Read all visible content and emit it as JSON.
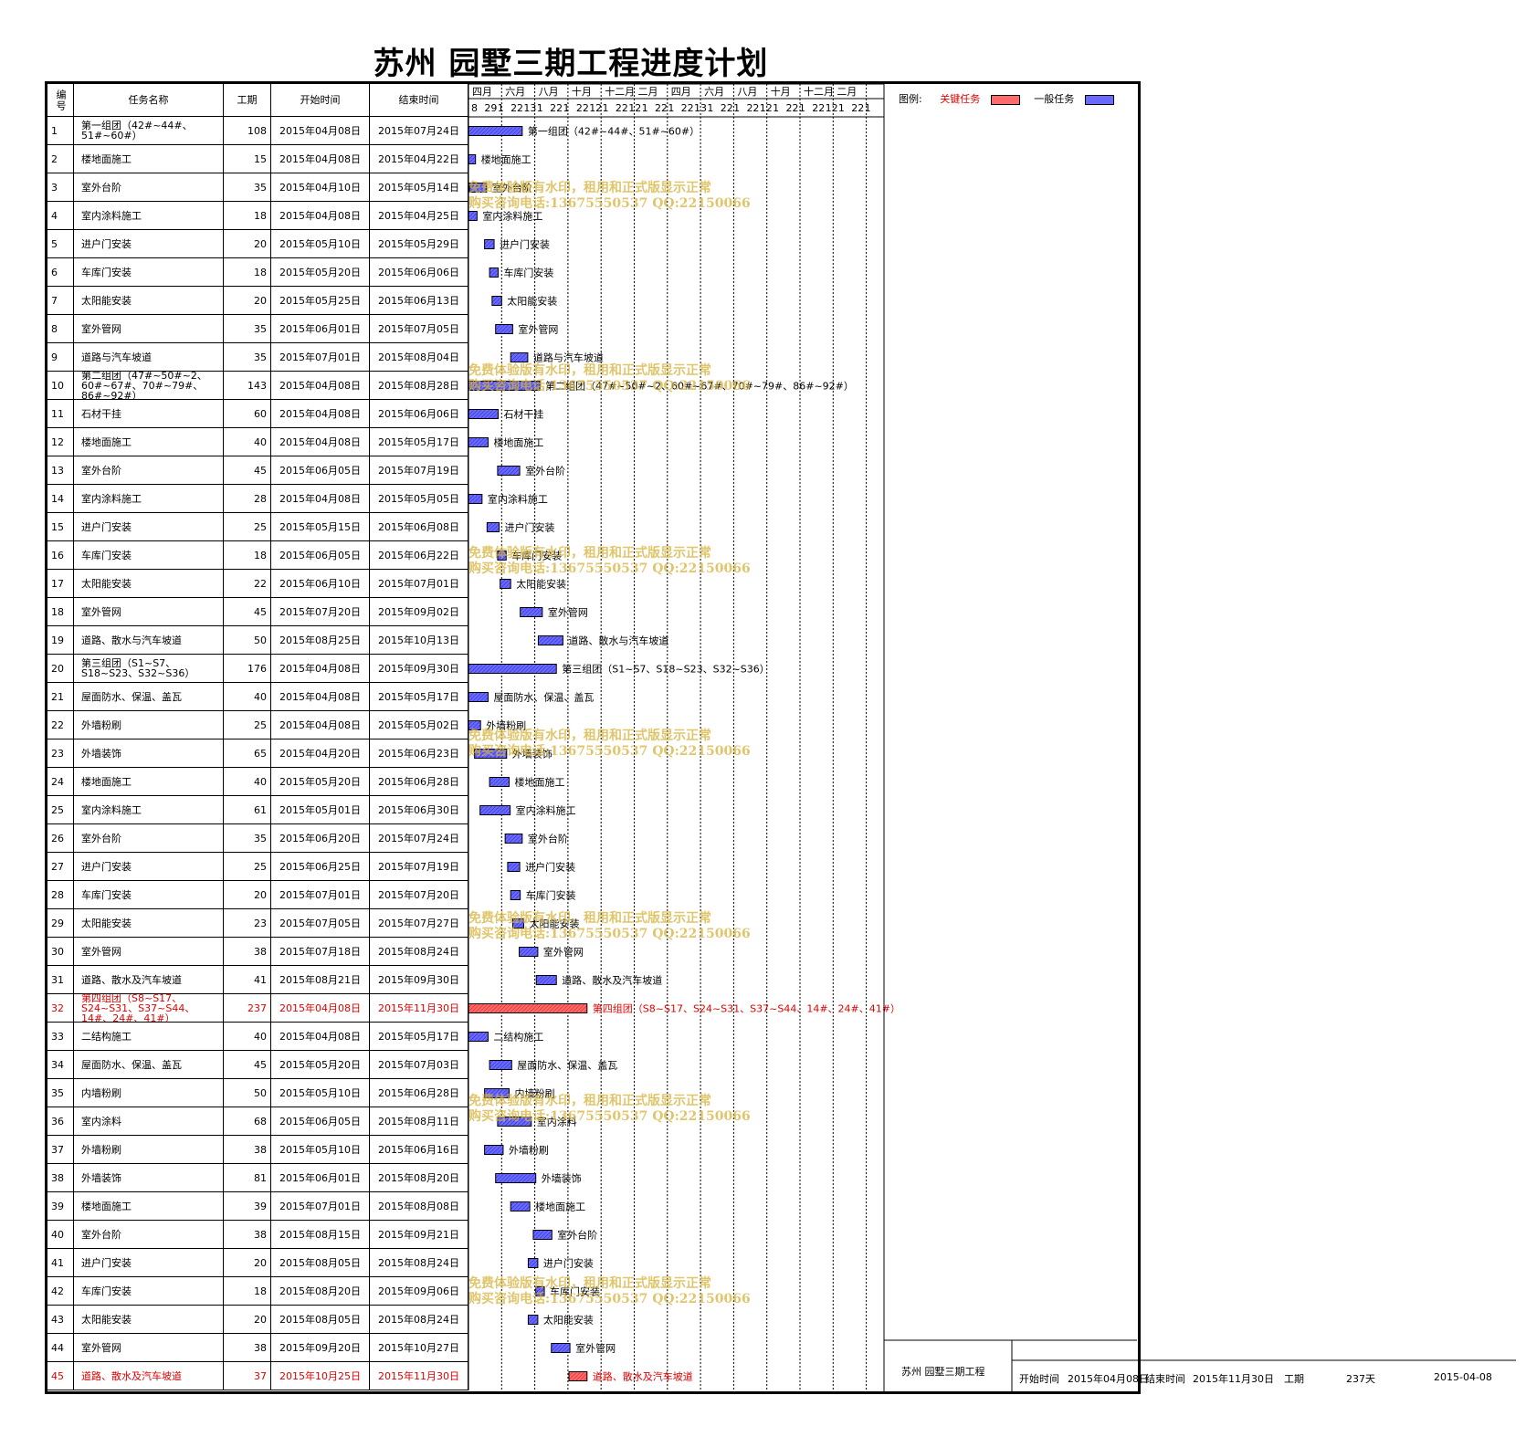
{
  "title": "苏州  园墅三期工程进度计划",
  "headers": {
    "no": "编号",
    "name": "任务名称",
    "duration": "工期",
    "start": "开始时间",
    "end": "结束时间"
  },
  "timeline": {
    "months": [
      "四月",
      "六月",
      "八月",
      "十月",
      "十二月",
      "二月",
      "四月",
      "六月",
      "八月",
      "十月",
      "十二月",
      "二月"
    ],
    "days": [
      "8",
      "29",
      "1",
      "22",
      "13",
      "1",
      "22",
      "1",
      "22",
      "12",
      "1",
      "22",
      "12",
      "1",
      "22",
      "1",
      "22",
      "13",
      "1",
      "22",
      "1",
      "22",
      "12",
      "1",
      "22",
      "1",
      "22",
      "12",
      "1",
      "22",
      "1"
    ]
  },
  "legend": {
    "label": "图例:",
    "critical": "关键任务",
    "normal": "一般任务",
    "critical_color": "#ff3333",
    "normal_color": "#4444ff"
  },
  "watermark": {
    "line1": "免费体验版有水印，租用和正式版显示正常",
    "line2": "购买咨询电话:13675550537 QQ:22150066"
  },
  "footer": {
    "project": "苏州 园墅三期工程",
    "start_label": "开始时间",
    "start_value": "2015年04月08日",
    "end_label": "结束时间",
    "end_value": "2015年11月30日",
    "dur_label": "工期",
    "dur_value": "237天",
    "date": "2015-04-08"
  },
  "chart_data": {
    "type": "gantt",
    "x_start": "2015-04-08",
    "tasks": [
      {
        "no": "1",
        "name": "第一组团（42#~44#、51#~60#）",
        "duration": 108,
        "start": "2015年04月08日",
        "end": "2015年07月24日",
        "s": "2015-04-08",
        "e": "2015-07-24",
        "critical": false
      },
      {
        "no": "2",
        "name": "楼地面施工",
        "duration": 15,
        "start": "2015年04月08日",
        "end": "2015年04月22日",
        "s": "2015-04-08",
        "e": "2015-04-22",
        "critical": false
      },
      {
        "no": "3",
        "name": "室外台阶",
        "duration": 35,
        "start": "2015年04月10日",
        "end": "2015年05月14日",
        "s": "2015-04-10",
        "e": "2015-05-14",
        "critical": false
      },
      {
        "no": "4",
        "name": "室内涂料施工",
        "duration": 18,
        "start": "2015年04月08日",
        "end": "2015年04月25日",
        "s": "2015-04-08",
        "e": "2015-04-25",
        "critical": false
      },
      {
        "no": "5",
        "name": "进户门安装",
        "duration": 20,
        "start": "2015年05月10日",
        "end": "2015年05月29日",
        "s": "2015-05-10",
        "e": "2015-05-29",
        "critical": false
      },
      {
        "no": "6",
        "name": "车库门安装",
        "duration": 18,
        "start": "2015年05月20日",
        "end": "2015年06月06日",
        "s": "2015-05-20",
        "e": "2015-06-06",
        "critical": false
      },
      {
        "no": "7",
        "name": "太阳能安装",
        "duration": 20,
        "start": "2015年05月25日",
        "end": "2015年06月13日",
        "s": "2015-05-25",
        "e": "2015-06-13",
        "critical": false
      },
      {
        "no": "8",
        "name": "室外管网",
        "duration": 35,
        "start": "2015年06月01日",
        "end": "2015年07月05日",
        "s": "2015-06-01",
        "e": "2015-07-05",
        "critical": false
      },
      {
        "no": "9",
        "name": "道路与汽车坡道",
        "duration": 35,
        "start": "2015年07月01日",
        "end": "2015年08月04日",
        "s": "2015-07-01",
        "e": "2015-08-04",
        "critical": false
      },
      {
        "no": "10",
        "name": "第二组团（47#~50#~2、60#~67#、70#~79#、86#~92#）",
        "duration": 143,
        "start": "2015年04月08日",
        "end": "2015年08月28日",
        "s": "2015-04-08",
        "e": "2015-08-28",
        "critical": false
      },
      {
        "no": "11",
        "name": "石材干挂",
        "duration": 60,
        "start": "2015年04月08日",
        "end": "2015年06月06日",
        "s": "2015-04-08",
        "e": "2015-06-06",
        "critical": false
      },
      {
        "no": "12",
        "name": "楼地面施工",
        "duration": 40,
        "start": "2015年04月08日",
        "end": "2015年05月17日",
        "s": "2015-04-08",
        "e": "2015-05-17",
        "critical": false
      },
      {
        "no": "13",
        "name": "室外台阶",
        "duration": 45,
        "start": "2015年06月05日",
        "end": "2015年07月19日",
        "s": "2015-06-05",
        "e": "2015-07-19",
        "critical": false
      },
      {
        "no": "14",
        "name": "室内涂料施工",
        "duration": 28,
        "start": "2015年04月08日",
        "end": "2015年05月05日",
        "s": "2015-04-08",
        "e": "2015-05-05",
        "critical": false
      },
      {
        "no": "15",
        "name": "进户门安装",
        "duration": 25,
        "start": "2015年05月15日",
        "end": "2015年06月08日",
        "s": "2015-05-15",
        "e": "2015-06-08",
        "critical": false
      },
      {
        "no": "16",
        "name": "车库门安装",
        "duration": 18,
        "start": "2015年06月05日",
        "end": "2015年06月22日",
        "s": "2015-06-05",
        "e": "2015-06-22",
        "critical": false
      },
      {
        "no": "17",
        "name": "太阳能安装",
        "duration": 22,
        "start": "2015年06月10日",
        "end": "2015年07月01日",
        "s": "2015-06-10",
        "e": "2015-07-01",
        "critical": false
      },
      {
        "no": "18",
        "name": "室外管网",
        "duration": 45,
        "start": "2015年07月20日",
        "end": "2015年09月02日",
        "s": "2015-07-20",
        "e": "2015-09-02",
        "critical": false
      },
      {
        "no": "19",
        "name": "道路、散水与汽车坡道",
        "duration": 50,
        "start": "2015年08月25日",
        "end": "2015年10月13日",
        "s": "2015-08-25",
        "e": "2015-10-13",
        "critical": false
      },
      {
        "no": "20",
        "name": "第三组团（S1~S7、S18~S23、S32~S36）",
        "duration": 176,
        "start": "2015年04月08日",
        "end": "2015年09月30日",
        "s": "2015-04-08",
        "e": "2015-09-30",
        "critical": false
      },
      {
        "no": "21",
        "name": "屋面防水、保温、盖瓦",
        "duration": 40,
        "start": "2015年04月08日",
        "end": "2015年05月17日",
        "s": "2015-04-08",
        "e": "2015-05-17",
        "critical": false
      },
      {
        "no": "22",
        "name": "外墙粉刷",
        "duration": 25,
        "start": "2015年04月08日",
        "end": "2015年05月02日",
        "s": "2015-04-08",
        "e": "2015-05-02",
        "critical": false
      },
      {
        "no": "23",
        "name": "外墙装饰",
        "duration": 65,
        "start": "2015年04月20日",
        "end": "2015年06月23日",
        "s": "2015-04-20",
        "e": "2015-06-23",
        "critical": false
      },
      {
        "no": "24",
        "name": "楼地面施工",
        "duration": 40,
        "start": "2015年05月20日",
        "end": "2015年06月28日",
        "s": "2015-05-20",
        "e": "2015-06-28",
        "critical": false
      },
      {
        "no": "25",
        "name": "室内涂料施工",
        "duration": 61,
        "start": "2015年05月01日",
        "end": "2015年06月30日",
        "s": "2015-05-01",
        "e": "2015-06-30",
        "critical": false
      },
      {
        "no": "26",
        "name": "室外台阶",
        "duration": 35,
        "start": "2015年06月20日",
        "end": "2015年07月24日",
        "s": "2015-06-20",
        "e": "2015-07-24",
        "critical": false
      },
      {
        "no": "27",
        "name": "进户门安装",
        "duration": 25,
        "start": "2015年06月25日",
        "end": "2015年07月19日",
        "s": "2015-06-25",
        "e": "2015-07-19",
        "critical": false
      },
      {
        "no": "28",
        "name": "车库门安装",
        "duration": 20,
        "start": "2015年07月01日",
        "end": "2015年07月20日",
        "s": "2015-07-01",
        "e": "2015-07-20",
        "critical": false
      },
      {
        "no": "29",
        "name": "太阳能安装",
        "duration": 23,
        "start": "2015年07月05日",
        "end": "2015年07月27日",
        "s": "2015-07-05",
        "e": "2015-07-27",
        "critical": false
      },
      {
        "no": "30",
        "name": "室外管网",
        "duration": 38,
        "start": "2015年07月18日",
        "end": "2015年08月24日",
        "s": "2015-07-18",
        "e": "2015-08-24",
        "critical": false
      },
      {
        "no": "31",
        "name": "道路、散水及汽车坡道",
        "duration": 41,
        "start": "2015年08月21日",
        "end": "2015年09月30日",
        "s": "2015-08-21",
        "e": "2015-09-30",
        "critical": false
      },
      {
        "no": "32",
        "name": "第四组团（S8~S17、S24~S31、S37~S44、14#、24#、41#）",
        "duration": 237,
        "start": "2015年04月08日",
        "end": "2015年11月30日",
        "s": "2015-04-08",
        "e": "2015-11-30",
        "critical": true
      },
      {
        "no": "33",
        "name": "二结构施工",
        "duration": 40,
        "start": "2015年04月08日",
        "end": "2015年05月17日",
        "s": "2015-04-08",
        "e": "2015-05-17",
        "critical": false
      },
      {
        "no": "34",
        "name": "屋面防水、保温、盖瓦",
        "duration": 45,
        "start": "2015年05月20日",
        "end": "2015年07月03日",
        "s": "2015-05-20",
        "e": "2015-07-03",
        "critical": false
      },
      {
        "no": "35",
        "name": "内墙粉刷",
        "duration": 50,
        "start": "2015年05月10日",
        "end": "2015年06月28日",
        "s": "2015-05-10",
        "e": "2015-06-28",
        "critical": false
      },
      {
        "no": "36",
        "name": "室内涂料",
        "duration": 68,
        "start": "2015年06月05日",
        "end": "2015年08月11日",
        "s": "2015-06-05",
        "e": "2015-08-11",
        "critical": false
      },
      {
        "no": "37",
        "name": "外墙粉刷",
        "duration": 38,
        "start": "2015年05月10日",
        "end": "2015年06月16日",
        "s": "2015-05-10",
        "e": "2015-06-16",
        "critical": false
      },
      {
        "no": "38",
        "name": "外墙装饰",
        "duration": 81,
        "start": "2015年06月01日",
        "end": "2015年08月20日",
        "s": "2015-06-01",
        "e": "2015-08-20",
        "critical": false
      },
      {
        "no": "39",
        "name": "楼地面施工",
        "duration": 39,
        "start": "2015年07月01日",
        "end": "2015年08月08日",
        "s": "2015-07-01",
        "e": "2015-08-08",
        "critical": false
      },
      {
        "no": "40",
        "name": "室外台阶",
        "duration": 38,
        "start": "2015年08月15日",
        "end": "2015年09月21日",
        "s": "2015-08-15",
        "e": "2015-09-21",
        "critical": false
      },
      {
        "no": "41",
        "name": "进户门安装",
        "duration": 20,
        "start": "2015年08月05日",
        "end": "2015年08月24日",
        "s": "2015-08-05",
        "e": "2015-08-24",
        "critical": false
      },
      {
        "no": "42",
        "name": "车库门安装",
        "duration": 18,
        "start": "2015年08月20日",
        "end": "2015年09月06日",
        "s": "2015-08-20",
        "e": "2015-09-06",
        "critical": false
      },
      {
        "no": "43",
        "name": "太阳能安装",
        "duration": 20,
        "start": "2015年08月05日",
        "end": "2015年08月24日",
        "s": "2015-08-05",
        "e": "2015-08-24",
        "critical": false
      },
      {
        "no": "44",
        "name": "室外管网",
        "duration": 38,
        "start": "2015年09月20日",
        "end": "2015年10月27日",
        "s": "2015-09-20",
        "e": "2015-10-27",
        "critical": false
      },
      {
        "no": "45",
        "name": "道路、散水及汽车坡道",
        "duration": 37,
        "start": "2015年10月25日",
        "end": "2015年11月30日",
        "s": "2015-10-25",
        "e": "2015-11-30",
        "critical": true
      }
    ]
  }
}
